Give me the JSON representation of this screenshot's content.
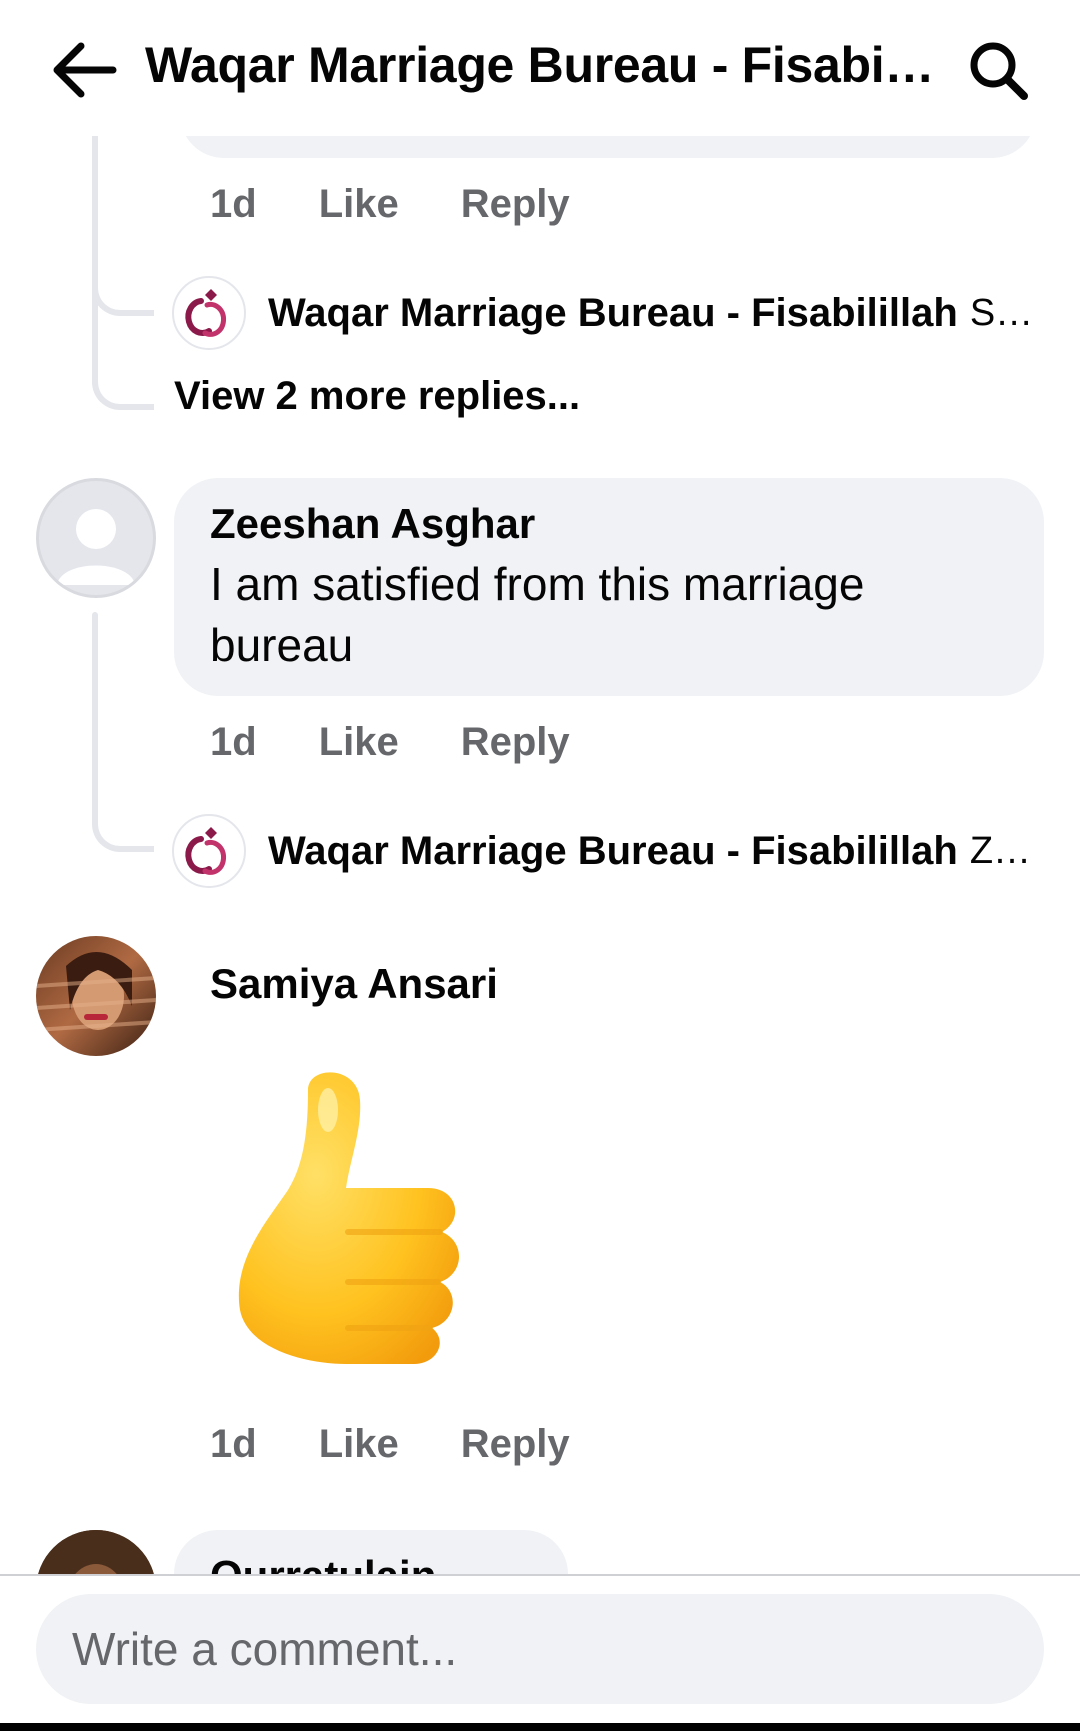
{
  "header": {
    "title": "Waqar Marriage Bureau - Fisabilillah",
    "back_icon": "arrow-left-icon",
    "search_icon": "search-icon"
  },
  "thread": {
    "first_actions": {
      "time": "1d",
      "like": "Like",
      "reply": "Reply"
    },
    "reply_preview_1": {
      "author": "Waqar Marriage Bureau - Fisabilillah",
      "snippet": "Sh..."
    },
    "view_more": "View 2 more replies...",
    "comments": [
      {
        "author": "Zeeshan Asghar",
        "text_line1": "I am satisfied from this marriage",
        "text_line2": "bureau",
        "time": "1d",
        "like": "Like",
        "reply": "Reply",
        "reply_preview": {
          "author": "Waqar Marriage Bureau - Fisabilillah",
          "snippet": "Ze..."
        }
      },
      {
        "author": "Samiya Ansari",
        "sticker": "thumbs-up-sticker",
        "time": "1d",
        "like": "Like",
        "reply": "Reply"
      },
      {
        "author": "Qurratulain Khan"
      }
    ]
  },
  "composer": {
    "placeholder": "Write a comment..."
  },
  "colors": {
    "bubble": "#f0f2f5",
    "secondary_text": "#65676b",
    "brand_maroon": "#8b1a4a"
  }
}
